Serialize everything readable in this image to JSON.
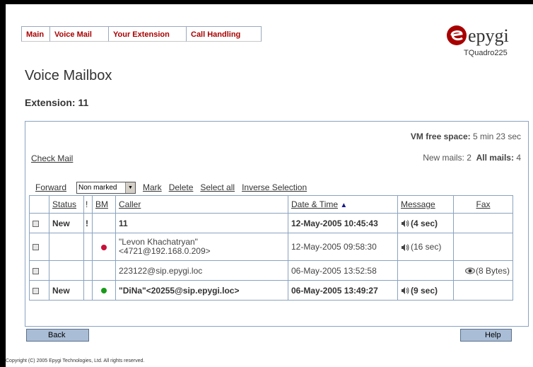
{
  "nav": {
    "tabs": [
      "Main",
      "Voice Mail",
      "Your Extension",
      "Call Handling"
    ]
  },
  "brand": {
    "logo_text": "epygi",
    "device": "TQuadro225",
    "accent": "#a80000"
  },
  "page": {
    "title": "Voice Mailbox",
    "extension": "Extension: 11"
  },
  "status": {
    "vm_free_label": "VM free space:",
    "vm_free_value": "5 min 23 sec",
    "new_mails_label": "New mails:",
    "new_mails_value": "2",
    "all_mails_label": "All mails:",
    "all_mails_value": "4"
  },
  "actions": {
    "check_mail": "Check Mail",
    "forward": "Forward",
    "mark_select_value": "Non marked",
    "mark": "Mark",
    "delete": "Delete",
    "select_all": "Select all",
    "inverse_selection": "Inverse Selection"
  },
  "table": {
    "headers": [
      "Status",
      "!",
      "BM",
      "Caller",
      "Date & Time",
      "Message",
      "Fax"
    ],
    "sort_indicator": "▲",
    "rows": [
      {
        "status": "New",
        "priority": "!",
        "bm_color": "",
        "caller": "11",
        "datetime": "12-May-2005 10:45:43",
        "message": "(4 sec)",
        "fax": ""
      },
      {
        "status": "",
        "priority": "",
        "bm_color": "#c8103a",
        "caller": "\"Levon Khachatryan\"<4721@192.168.0.209>",
        "datetime": "12-May-2005 09:58:30",
        "message": "(16 sec)",
        "fax": ""
      },
      {
        "status": "",
        "priority": "",
        "bm_color": "",
        "caller": "223122@sip.epygi.loc",
        "datetime": "06-May-2005 13:52:58",
        "message": "",
        "fax": "(8 Bytes)"
      },
      {
        "status": "New",
        "priority": "",
        "bm_color": "#1a9a1a",
        "caller": "\"DiNa\"<20255@sip.epygi.loc>",
        "datetime": "06-May-2005 13:49:27",
        "message": "(9 sec)",
        "fax": ""
      }
    ]
  },
  "buttons": {
    "back": "Back",
    "help": "Help"
  },
  "footer": {
    "copyright": "Copyright (C) 2005 Epygi Technologies, Ltd. All rights reserved."
  }
}
